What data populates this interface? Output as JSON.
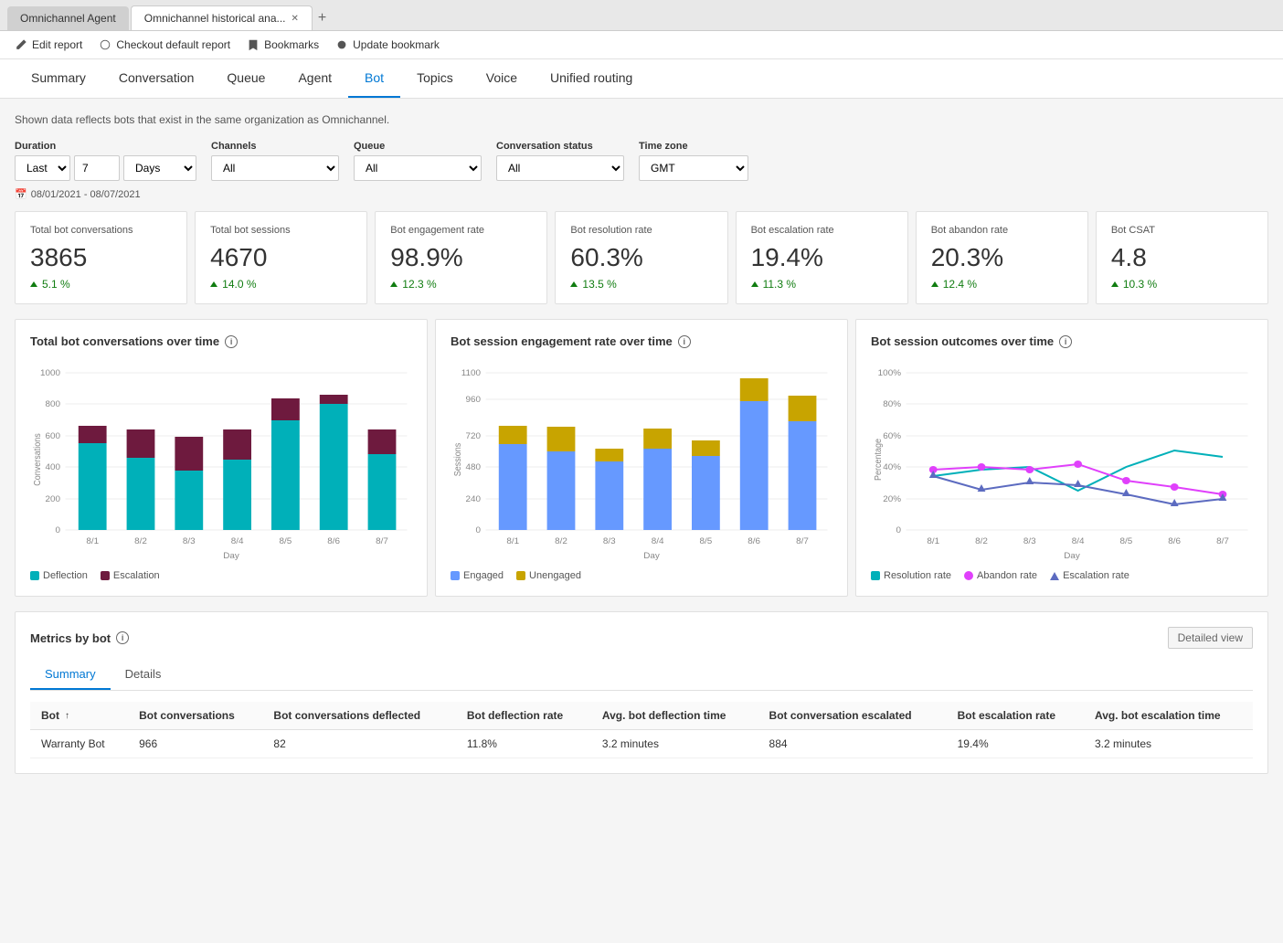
{
  "browser": {
    "tabs": [
      {
        "label": "Omnichannel Agent",
        "active": false
      },
      {
        "label": "Omnichannel historical ana...",
        "active": true
      }
    ],
    "add_tab": "+"
  },
  "toolbar": {
    "edit_report": "Edit report",
    "checkout": "Checkout default report",
    "bookmarks": "Bookmarks",
    "update_bookmark": "Update bookmark"
  },
  "nav": {
    "tabs": [
      "Summary",
      "Conversation",
      "Queue",
      "Agent",
      "Bot",
      "Topics",
      "Voice",
      "Unified routing"
    ],
    "active": "Bot"
  },
  "info_text": "Shown data reflects bots that exist in the same organization as Omnichannel.",
  "filters": {
    "duration_label": "Duration",
    "duration_prefix": "Last",
    "duration_value": "7",
    "duration_unit": "Days",
    "channels_label": "Channels",
    "channels_value": "All",
    "queue_label": "Queue",
    "queue_value": "All",
    "conversation_status_label": "Conversation status",
    "conversation_status_value": "All",
    "time_zone_label": "Time zone",
    "time_zone_value": "GMT",
    "date_range": "08/01/2021 - 08/07/2021"
  },
  "kpis": [
    {
      "label": "Total bot conversations",
      "value": "3865",
      "change": "5.1 %",
      "up": true
    },
    {
      "label": "Total bot sessions",
      "value": "4670",
      "change": "14.0 %",
      "up": true
    },
    {
      "label": "Bot engagement rate",
      "value": "98.9%",
      "change": "12.3 %",
      "up": true
    },
    {
      "label": "Bot resolution rate",
      "value": "60.3%",
      "change": "13.5 %",
      "up": true
    },
    {
      "label": "Bot escalation rate",
      "value": "19.4%",
      "change": "11.3 %",
      "up": true
    },
    {
      "label": "Bot abandon rate",
      "value": "20.3%",
      "change": "12.4 %",
      "up": true
    },
    {
      "label": "Bot CSAT",
      "value": "4.8",
      "change": "10.3 %",
      "up": true
    }
  ],
  "charts": {
    "conversations_over_time": {
      "title": "Total bot conversations over time",
      "y_labels": [
        "1000",
        "800",
        "600",
        "400",
        "200",
        "0"
      ],
      "x_labels": [
        "8/1",
        "8/2",
        "8/3",
        "8/4",
        "8/5",
        "8/6",
        "8/7"
      ],
      "x_axis_label": "Day",
      "y_axis_label": "Conversations",
      "legend": [
        {
          "label": "Deflection",
          "color": "#00b0b9"
        },
        {
          "label": "Escalation",
          "color": "#6e1a3e"
        }
      ],
      "bars": [
        {
          "deflection": 550,
          "escalation": 110
        },
        {
          "deflection": 460,
          "escalation": 175
        },
        {
          "deflection": 380,
          "escalation": 215
        },
        {
          "deflection": 450,
          "escalation": 190
        },
        {
          "deflection": 700,
          "escalation": 140
        },
        {
          "deflection": 800,
          "escalation": 60
        },
        {
          "deflection": 480,
          "escalation": 155
        }
      ]
    },
    "engagement_rate": {
      "title": "Bot session engagement rate over time",
      "y_labels": [
        "1100",
        "960",
        "720",
        "480",
        "240",
        "0"
      ],
      "x_labels": [
        "8/1",
        "8/2",
        "8/3",
        "8/4",
        "8/5",
        "8/6",
        "8/7"
      ],
      "x_axis_label": "Day",
      "y_axis_label": "Sessions",
      "legend": [
        {
          "label": "Engaged",
          "color": "#6699ff"
        },
        {
          "label": "Unengaged",
          "color": "#c8a400"
        }
      ],
      "bars": [
        {
          "engaged": 600,
          "unengaged": 130
        },
        {
          "engaged": 550,
          "unengaged": 170
        },
        {
          "engaged": 480,
          "unengaged": 90
        },
        {
          "engaged": 570,
          "unengaged": 140
        },
        {
          "engaged": 520,
          "unengaged": 110
        },
        {
          "engaged": 900,
          "unengaged": 160
        },
        {
          "engaged": 760,
          "unengaged": 180
        }
      ]
    },
    "outcomes_over_time": {
      "title": "Bot session outcomes over time",
      "y_labels": [
        "100%",
        "80%",
        "60%",
        "40%",
        "20%",
        "0"
      ],
      "x_labels": [
        "8/1",
        "8/2",
        "8/3",
        "8/4",
        "8/5",
        "8/6",
        "8/7"
      ],
      "x_axis_label": "Day",
      "y_axis_label": "Percentage",
      "legend": [
        {
          "label": "Resolution rate",
          "color": "#00b0b9",
          "type": "line"
        },
        {
          "label": "Abandon rate",
          "color": "#e040fb",
          "type": "circle"
        },
        {
          "label": "Escalation rate",
          "color": "#5c6bc0",
          "type": "triangle"
        }
      ]
    }
  },
  "metrics_by_bot": {
    "title": "Metrics by bot",
    "detailed_view_btn": "Detailed view",
    "sub_tabs": [
      "Summary",
      "Details"
    ],
    "active_sub_tab": "Summary",
    "columns": [
      {
        "label": "Bot",
        "sortable": true
      },
      {
        "label": "Bot conversations",
        "sortable": false
      },
      {
        "label": "Bot conversations deflected",
        "sortable": false
      },
      {
        "label": "Bot deflection rate",
        "sortable": false
      },
      {
        "label": "Avg. bot deflection time",
        "sortable": false
      },
      {
        "label": "Bot conversation escalated",
        "sortable": false
      },
      {
        "label": "Bot escalation rate",
        "sortable": false
      },
      {
        "label": "Avg. bot escalation time",
        "sortable": false
      }
    ],
    "rows": [
      {
        "bot": "Warranty Bot",
        "conversations": "966",
        "deflected": "82",
        "deflection_rate": "11.8%",
        "avg_deflection": "3.2 minutes",
        "escalated": "884",
        "escalation_rate": "19.4%",
        "avg_escalation": "3.2 minutes"
      }
    ]
  }
}
